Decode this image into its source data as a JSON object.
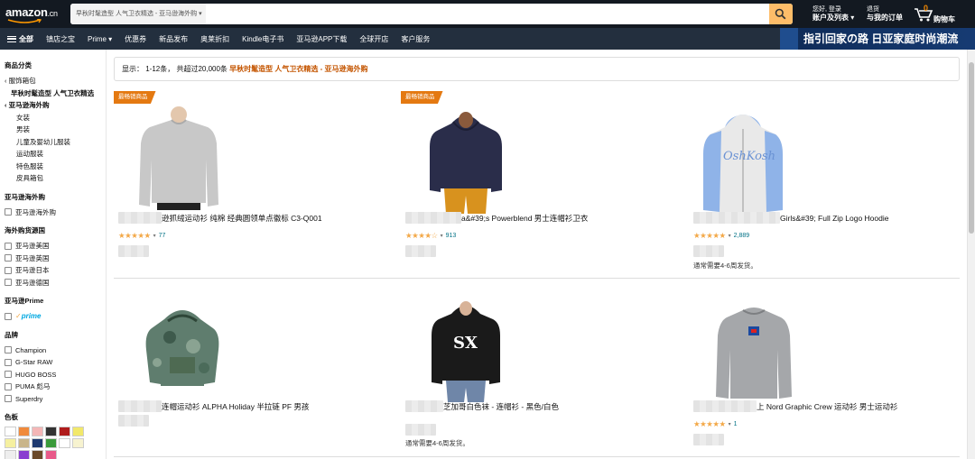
{
  "header": {
    "logo_text": "amazon",
    "logo_suffix": ".cn",
    "search_department": "早秋时髦造型 人气卫衣精选 - 亚马逊海外购 ▾",
    "search_placeholder": "",
    "account_line1": "您好, 登录",
    "account_line2": "账户及列表 ▾",
    "orders_line1": "退货",
    "orders_line2": "与我的订单",
    "cart_count": "0",
    "cart_label": "购物车"
  },
  "subnav": {
    "all_label": "全部",
    "items": [
      "镇店之宝",
      "Prime ▾",
      "优惠券",
      "新品发布",
      "奥莱折扣",
      "Kindle电子书",
      "亚马逊APP下载",
      "全球开店",
      "客户服务"
    ],
    "banner_text": "指引回家の路 日亚家庭时尚潮流"
  },
  "sidebar": {
    "category_heading": "商品分类",
    "category_back": "‹ 服饰箱包",
    "category_current": "早秋时髦造型 人气卫衣精选",
    "category_sub": "‹ 亚马逊海外购",
    "category_items": [
      "女装",
      "男装",
      "儿童及婴幼儿服装",
      "运动服装",
      "特色服装",
      "皮具箱包"
    ],
    "global_heading": "亚马逊海外购",
    "global_option": "亚马逊海外购",
    "origin_heading": "海外购货源国",
    "origin_options": [
      "亚马逊美国",
      "亚马逊英国",
      "亚马逊日本",
      "亚马逊德国"
    ],
    "prime_heading": "亚马逊Prime",
    "prime_check": "✓",
    "prime_label": "prime",
    "brand_heading": "品牌",
    "brand_options": [
      "Champion",
      "G-Star RAW",
      "HUGO BOSS",
      "PUMA 彪马",
      "Superdry"
    ],
    "color_heading": "色板",
    "swatch_colors": [
      "#ffffff",
      "#f08a3c",
      "#f4b6b6",
      "#333333",
      "#b01c1c",
      "#f2e86a",
      "#f5f0a0",
      "#c9b58a",
      "#1f3a70",
      "#3a9a3a",
      "#ffffff",
      "#f7f3d0",
      "#eeeeee",
      "#8a3fd0",
      "#6b4a2a",
      "#e85a8a"
    ]
  },
  "results": {
    "prefix": "显示： 1-12条， 共超过20,000条",
    "query": "早秋时髦造型 人气卫衣精选 - 亚马逊海外购"
  },
  "products": [
    {
      "badge": "最畅销商品",
      "title": "逊抓绒运动衫 纯棉 经典圆领单点徽标 C3-Q001",
      "stars": "★★★★★",
      "rating_count": "77",
      "shipping": "",
      "image": "gray-crew-sweatshirt"
    },
    {
      "badge": "最畅销商品",
      "title": "a&#39;s Powerblend 男士连帽衫卫衣",
      "stars": "★★★★☆",
      "rating_count": "913",
      "shipping": "",
      "image": "navy-hoodie"
    },
    {
      "badge": "",
      "title": "Girls&#39; Full Zip Logo Hoodie",
      "stars": "★★★★★",
      "rating_count": "2,889",
      "shipping": "通常需要4-6周发货。",
      "image": "blue-zip-hoodie"
    },
    {
      "badge": "",
      "title": "连帽运动衫 ALPHA Holiday 半拉链 PF 男孩",
      "stars": "",
      "rating_count": "",
      "shipping": "",
      "image": "camo-hoodie"
    },
    {
      "badge": "",
      "title": "芝加哥白色袜 - 连帽衫 - 黑色/白色",
      "stars": "",
      "rating_count": "",
      "shipping": "通常需要4-6周发货。",
      "image": "black-sox-hoodie"
    },
    {
      "badge": "",
      "title": "上 Nord Graphic Crew 运动衫 男士运动衫",
      "stars": "★★★★★",
      "rating_count": "1",
      "shipping": "",
      "image": "gray-crew-logo"
    }
  ]
}
